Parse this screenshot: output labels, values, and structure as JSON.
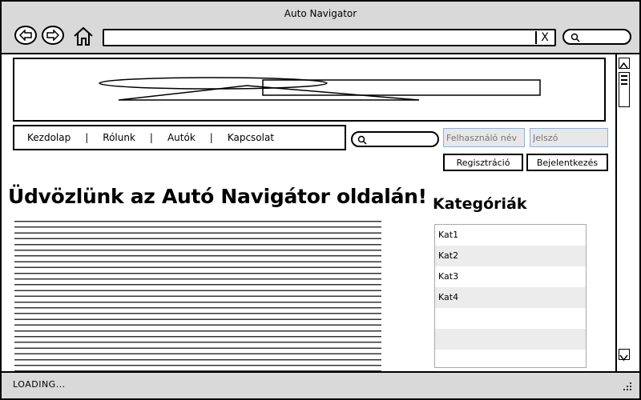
{
  "window": {
    "title": "Auto Navigator"
  },
  "browser": {
    "address_value": "",
    "clear_label": "X",
    "search_value": ""
  },
  "site": {
    "nav": [
      "Kezdolap",
      "Rólunk",
      "Autók",
      "Kapcsolat"
    ],
    "separator": "|",
    "search_value": "",
    "username_placeholder": "Felhasználó név",
    "password_placeholder": "Jelszó",
    "register_label": "Regisztráció",
    "login_label": "Bejelentkezés",
    "heading": "Üdvözlünk az Autó Navigátor oldalán!",
    "categories_title": "Kategóriák",
    "categories": [
      "Kat1",
      "Kat2",
      "Kat3",
      "Kat4",
      "",
      "",
      ""
    ]
  },
  "status": {
    "text": "LOADING..."
  },
  "icons": {
    "back": "arrow-left-icon",
    "forward": "arrow-right-icon",
    "home": "home-icon",
    "search": "search-icon",
    "resize": "resize-grip-icon"
  }
}
